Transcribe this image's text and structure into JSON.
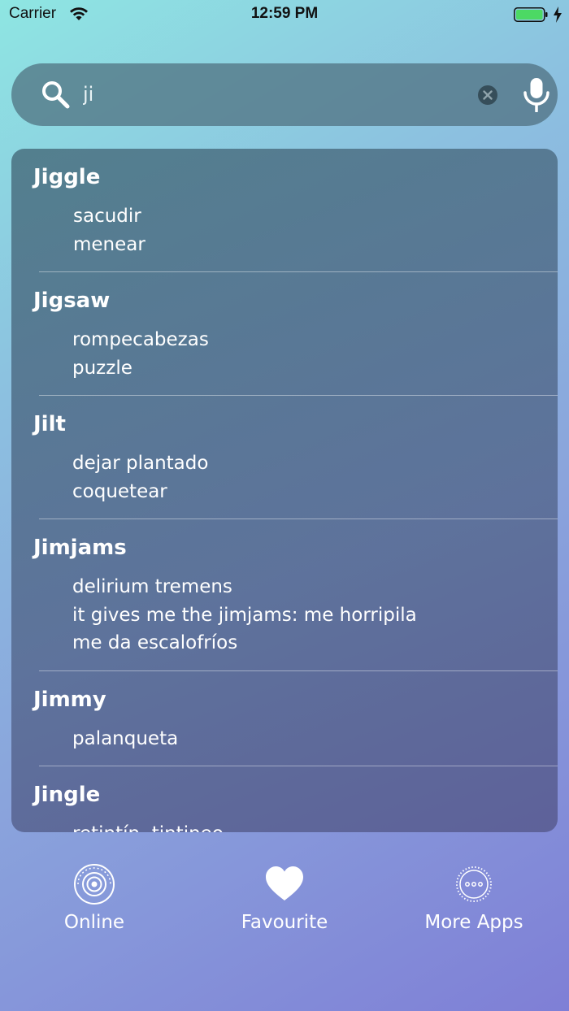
{
  "status_bar": {
    "carrier": "Carrier",
    "time": "12:59 PM",
    "battery_color": "#4cd964"
  },
  "search": {
    "value": "ji",
    "placeholder": ""
  },
  "results": [
    {
      "word": "Jiggle",
      "definitions": [
        "sacudir",
        "menear"
      ]
    },
    {
      "word": "Jigsaw",
      "definitions": [
        "rompecabezas",
        "puzzle"
      ]
    },
    {
      "word": "Jilt",
      "definitions": [
        "dejar plantado",
        "coquetear"
      ]
    },
    {
      "word": "Jimjams",
      "definitions": [
        "delirium tremens",
        "it gives me the jimjams: me horripila",
        "me da escalofríos"
      ]
    },
    {
      "word": "Jimmy",
      "definitions": [
        "palanqueta"
      ]
    },
    {
      "word": "Jingle",
      "definitions": [
        "retintín, tintineo"
      ]
    }
  ],
  "tabs": [
    {
      "label": "Online",
      "icon": "online-broadcast-icon"
    },
    {
      "label": "Favourite",
      "icon": "heart-icon"
    },
    {
      "label": "More Apps",
      "icon": "more-dots-icon"
    }
  ]
}
